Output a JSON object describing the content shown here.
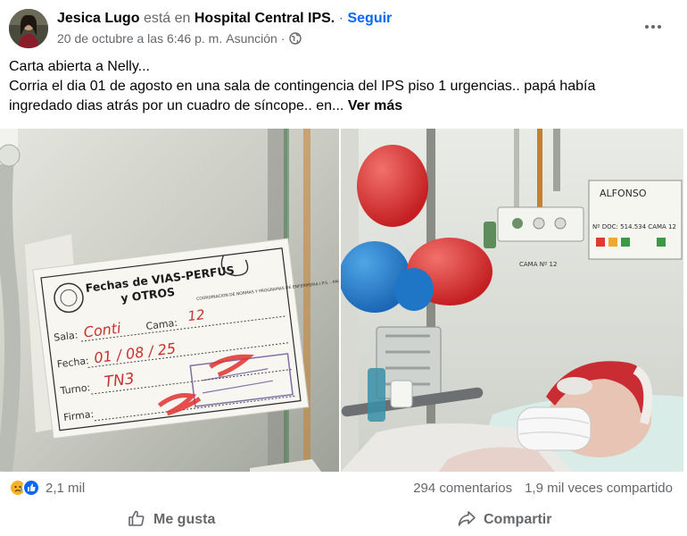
{
  "post": {
    "author": "Jesica Lugo",
    "connector": "está en",
    "place": "Hospital Central IPS.",
    "dot": "·",
    "follow_label": "Seguir",
    "date": "20 de octubre a las 6:46 p. m.",
    "location": "Asunción",
    "meta_dot": "·",
    "privacy_icon": "globe-icon",
    "text_line1": "Carta abierta a Nelly...",
    "text_line2": "Corria el dia 01 de agosto en una sala de contingencia del IPS piso 1 urgencias.. papá había",
    "text_line3": "ingredado dias atrás por un cuadro de síncope.. en...",
    "see_more_label": "Ver más"
  },
  "photo_left": {
    "label_title": "Fechas de VIAS-PERFUS",
    "label_subtitle": "y OTROS",
    "label_side": "COORDINACION DE NORMAS Y PROGRAMAS DE ENFERMERIA I.P.S. - PAIS",
    "sala_label": "Sala:",
    "sala_value": "Conti",
    "cama_label": "Cama:",
    "cama_value": "12",
    "fecha_label": "Fecha:",
    "fecha_value": "01 / 08 / 25",
    "turno_label": "Turno:",
    "turno_value": "TN3",
    "firma_label": "Firma:"
  },
  "photo_right": {
    "board_name": "ALFONSO",
    "board_number": "Nº DOC: 514.534 CAMA 12",
    "cama_sign": "CAMA Nº 12"
  },
  "stats": {
    "reaction_icons": [
      "sad-icon",
      "like-icon"
    ],
    "reaction_count": "2,1 mil",
    "comments": "294 comentarios",
    "shares": "1,9 mil veces compartido"
  },
  "actions": {
    "like_label": "Me gusta",
    "share_label": "Compartir"
  },
  "colors": {
    "link_blue": "#0866ff",
    "muted_text": "#65676b",
    "reaction_sad": "#f7b125",
    "reaction_like": "#0866ff"
  }
}
